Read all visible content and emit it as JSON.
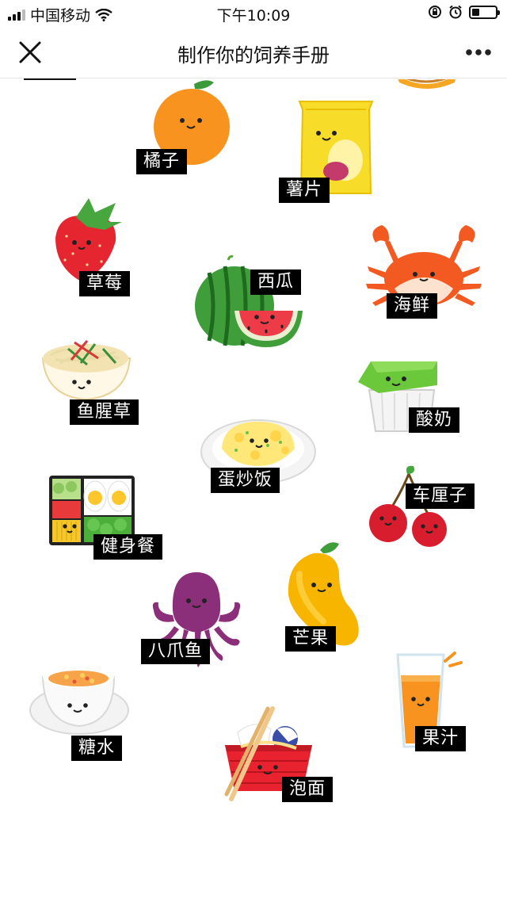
{
  "status_bar": {
    "carrier": "中国移动",
    "time": "下午10:09"
  },
  "nav": {
    "title": "制作你的饲养手册",
    "close_icon": "close-icon",
    "more_icon": "more-icon"
  },
  "foods": [
    {
      "id": "orange",
      "label": "橘子",
      "icon": "orange-icon"
    },
    {
      "id": "chips",
      "label": "薯片",
      "icon": "chips-bag-icon"
    },
    {
      "id": "strawberry",
      "label": "草莓",
      "icon": "strawberry-icon"
    },
    {
      "id": "watermelon",
      "label": "西瓜",
      "icon": "watermelon-icon"
    },
    {
      "id": "seafood",
      "label": "海鲜",
      "icon": "crab-icon"
    },
    {
      "id": "salad",
      "label": "鱼腥草",
      "icon": "salad-bowl-icon"
    },
    {
      "id": "yogurt",
      "label": "酸奶",
      "icon": "yogurt-cup-icon"
    },
    {
      "id": "fried-rice",
      "label": "蛋炒饭",
      "icon": "fried-rice-icon"
    },
    {
      "id": "cherry",
      "label": "车厘子",
      "icon": "cherry-icon"
    },
    {
      "id": "fitness-meal",
      "label": "健身餐",
      "icon": "bento-box-icon"
    },
    {
      "id": "octopus",
      "label": "八爪鱼",
      "icon": "octopus-icon"
    },
    {
      "id": "mango",
      "label": "芒果",
      "icon": "mango-icon"
    },
    {
      "id": "dessert-soup",
      "label": "糖水",
      "icon": "soup-bowl-icon"
    },
    {
      "id": "juice",
      "label": "果汁",
      "icon": "juice-glass-icon"
    },
    {
      "id": "instant-noodles",
      "label": "泡面",
      "icon": "noodle-cup-icon"
    }
  ]
}
